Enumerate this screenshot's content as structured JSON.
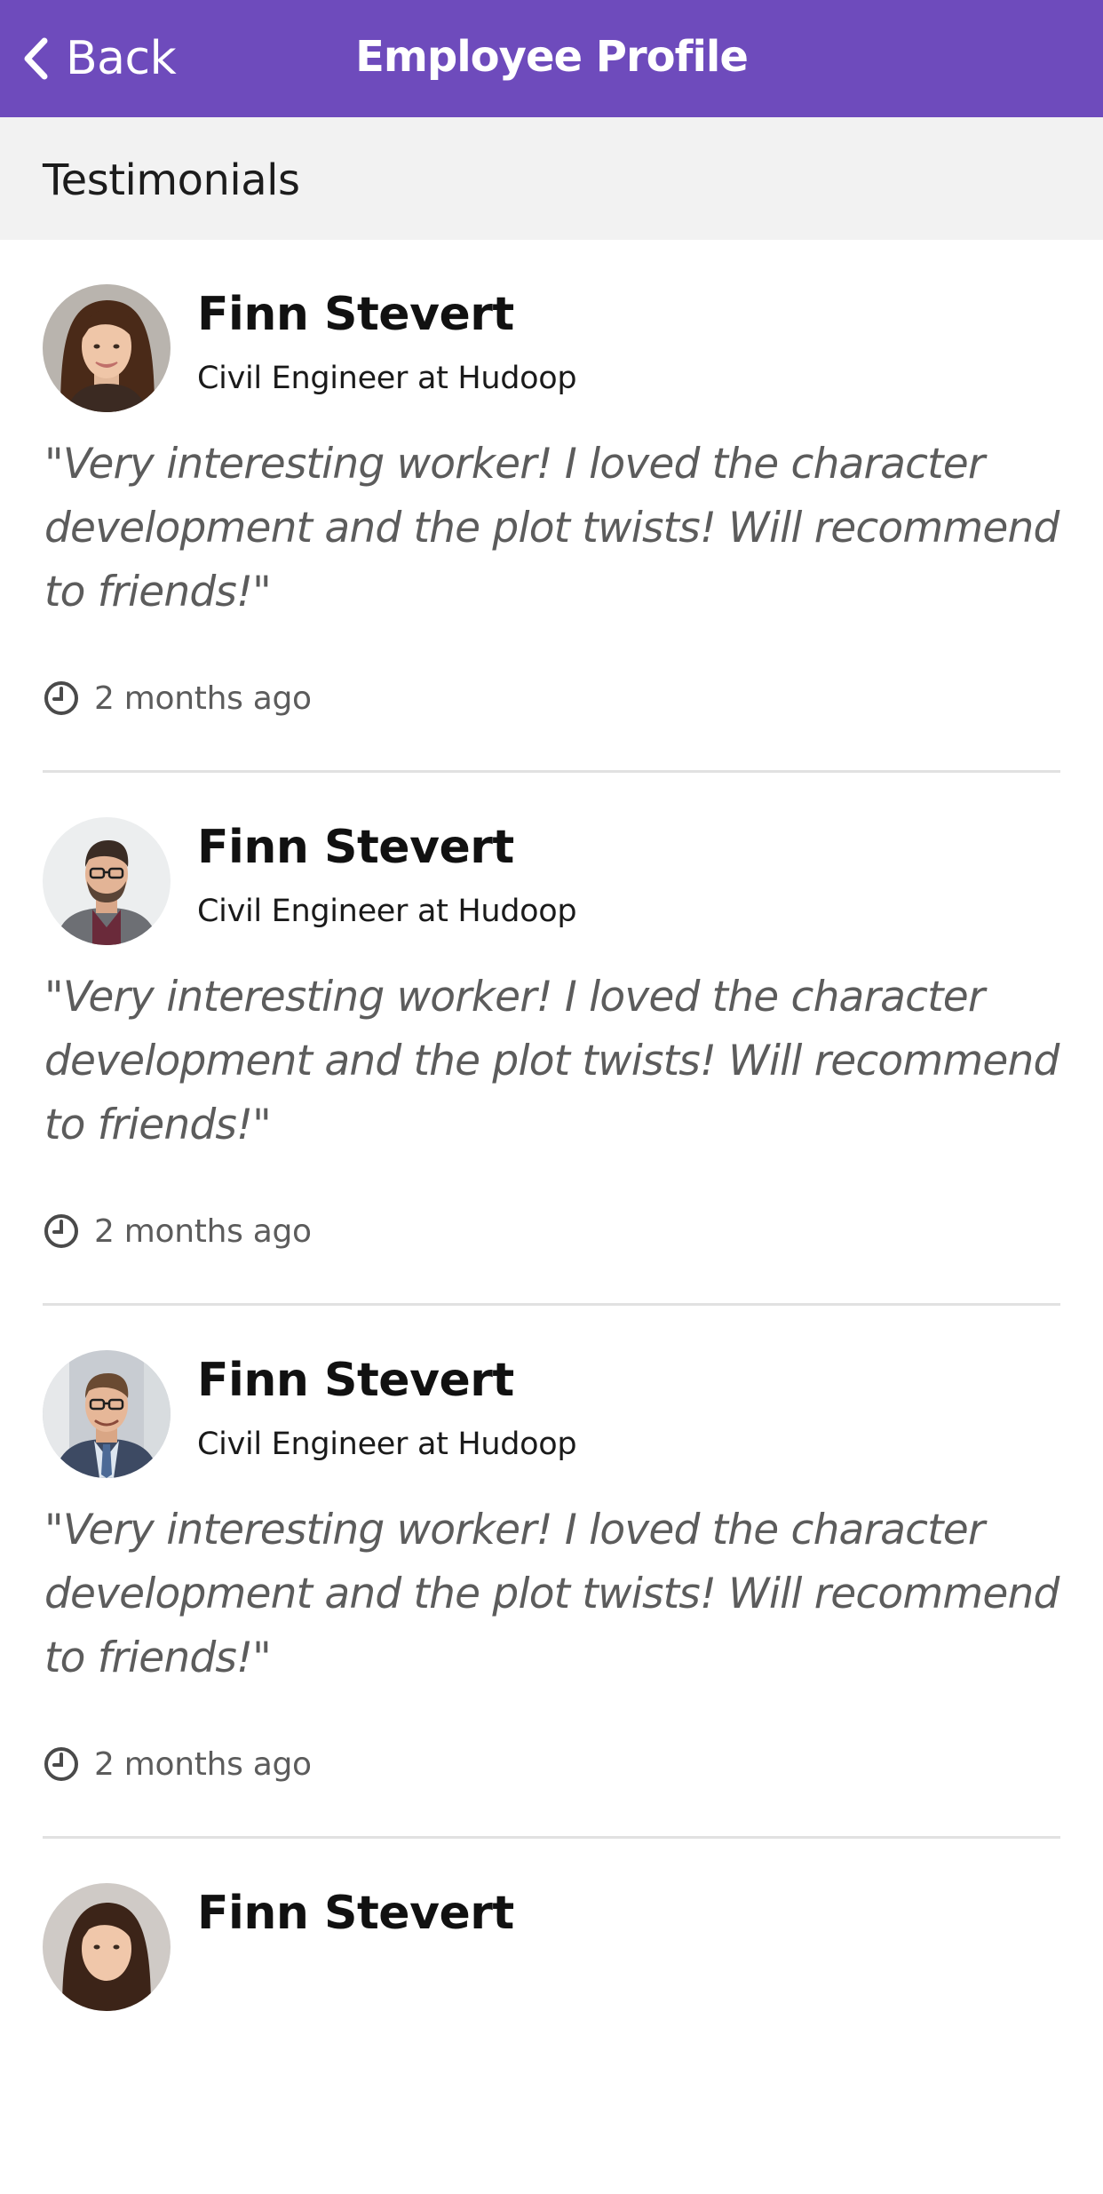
{
  "nav": {
    "back_label": "Back",
    "title": "Employee Profile",
    "bar_color": "#6e4bbc",
    "back_icon": "chevron-left-icon"
  },
  "section": {
    "title": "Testimonials"
  },
  "testimonials": [
    {
      "name": "Finn Stevert",
      "role": "Civil Engineer at Hudoop",
      "quote": "\"Very interesting worker! I loved the character development and the plot twists! Will recommend to friends!\"",
      "time": "2 months ago",
      "avatar": "avatar-woman-long-hair",
      "time_icon": "clock-icon"
    },
    {
      "name": "Finn Stevert",
      "role": "Civil Engineer at Hudoop",
      "quote": "\"Very interesting worker! I loved the character development and the plot twists! Will recommend to friends!\"",
      "time": "2 months ago",
      "avatar": "avatar-man-glasses-beard",
      "time_icon": "clock-icon"
    },
    {
      "name": "Finn Stevert",
      "role": "Civil Engineer at Hudoop",
      "quote": "\"Very interesting worker! I loved the character development and the plot twists! Will recommend to friends!\"",
      "time": "2 months ago",
      "avatar": "avatar-man-glasses-suit",
      "time_icon": "clock-icon"
    },
    {
      "name": "Finn Stevert",
      "avatar": "avatar-woman-dark-hair"
    }
  ]
}
